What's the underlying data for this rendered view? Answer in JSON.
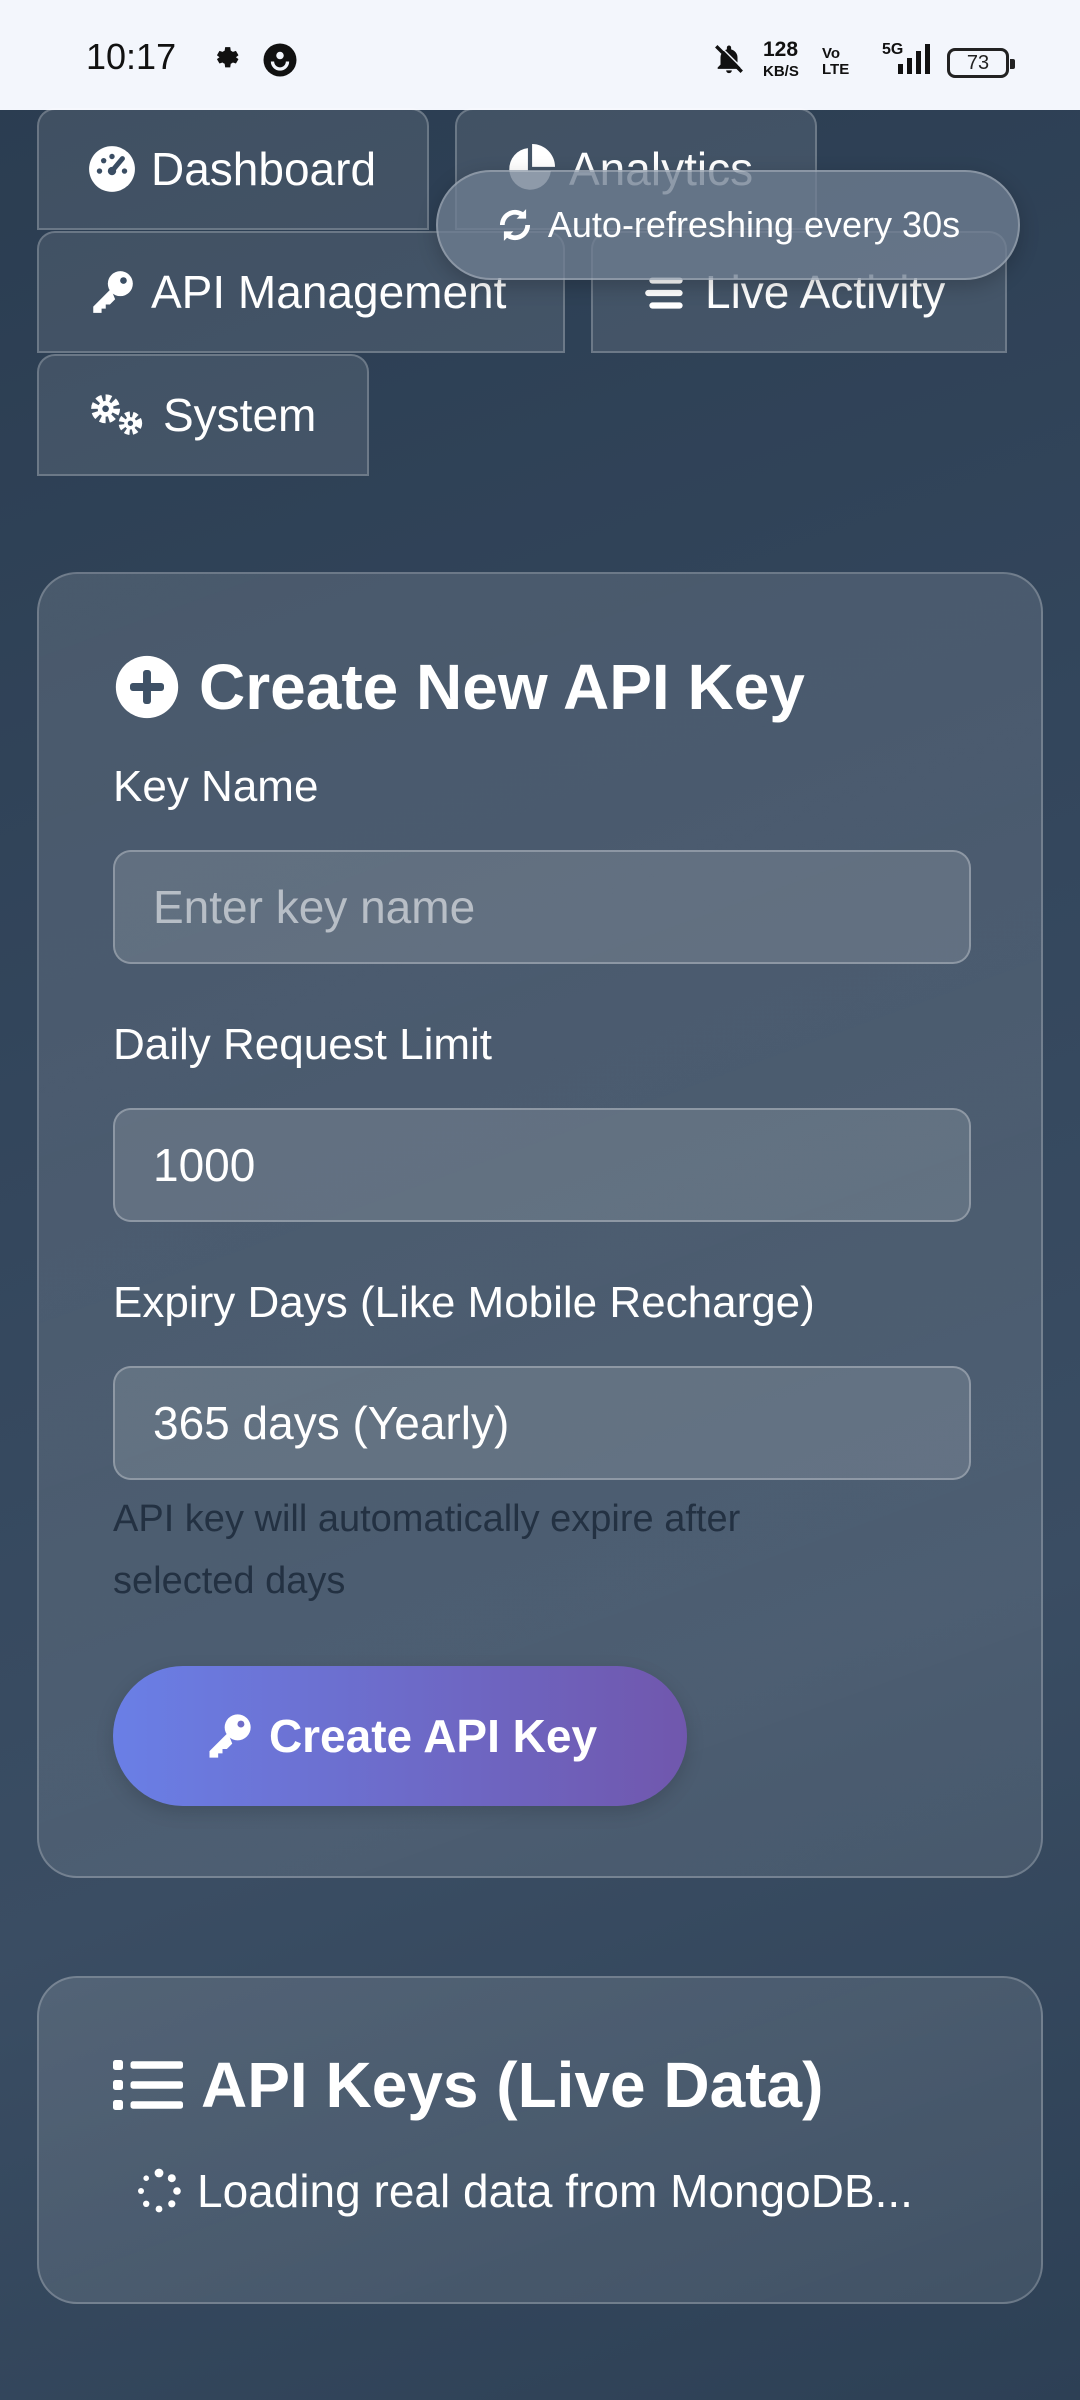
{
  "status_bar": {
    "time": "10:17",
    "speed_value": "128",
    "speed_unit": "KB/S",
    "volte_top": "Vo",
    "volte_bottom": "LTE",
    "network": "5G",
    "battery": "73"
  },
  "tabs": {
    "dashboard": "Dashboard",
    "analytics": "Analytics",
    "api_management": "API Management",
    "live_activity": "Live Activity",
    "system": "System"
  },
  "refresh_notice": "Auto-refreshing every 30s",
  "create_card": {
    "title": "Create New API Key",
    "key_name_label": "Key Name",
    "key_name_placeholder": "Enter key name",
    "limit_label": "Daily Request Limit",
    "limit_value": "1000",
    "expiry_label": "Expiry Days (Like Mobile Recharge)",
    "expiry_value": "365 days (Yearly)",
    "expiry_hint": "API key will automatically expire after selected days",
    "submit_label": "Create API Key"
  },
  "keys_card": {
    "title": "API Keys (Live Data)",
    "loading_text": "Loading real data from MongoDB..."
  },
  "icons": {
    "dashboard": "tachometer-icon",
    "analytics": "pie-chart-icon",
    "api_management": "key-icon",
    "live_activity": "stream-icon",
    "system": "cogs-icon",
    "refresh": "sync-icon",
    "create_title": "plus-circle-icon",
    "keys_title": "list-icon",
    "loading": "spinner-icon"
  }
}
